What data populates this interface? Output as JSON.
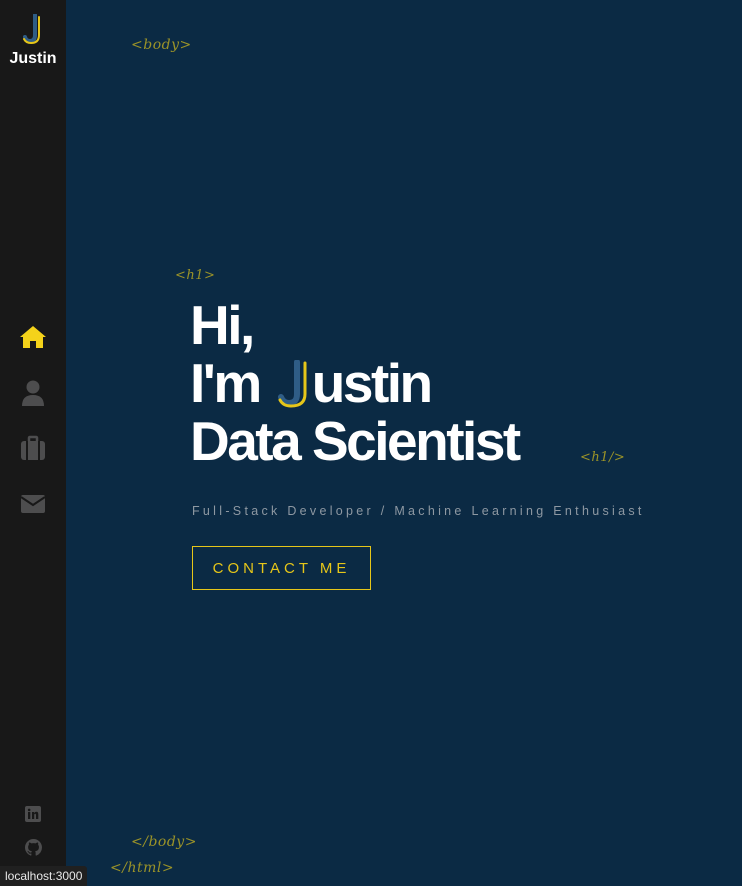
{
  "sidebar": {
    "logo_name": "Justin",
    "nav": [
      {
        "name": "home-icon",
        "active": true
      },
      {
        "name": "user-icon",
        "active": false
      },
      {
        "name": "briefcase-icon",
        "active": false
      },
      {
        "name": "envelope-icon",
        "active": false
      }
    ],
    "social": [
      "linkedin-icon",
      "github-icon"
    ]
  },
  "tags": {
    "body_open": "<body>",
    "h1_open": "<h1>",
    "h1_close": "<h1/>",
    "body_close": "</body>",
    "html_close": "</html>"
  },
  "hero": {
    "line1": "Hi,",
    "line2_prefix": "I'm",
    "line2_suffix": "ustin",
    "line3": "Data Scientist",
    "subtitle": "Full-Stack Developer / Machine Learning Enthusiast",
    "contact_label": "CONTACT ME"
  },
  "status_bar": {
    "url": "localhost:3000"
  },
  "colors": {
    "background": "#0b2a44",
    "sidebar": "#181818",
    "accent": "#e6c619",
    "tag": "#9b9328",
    "inactive_icon": "#4d4d4e",
    "logo_blue": "#2f5d86"
  }
}
